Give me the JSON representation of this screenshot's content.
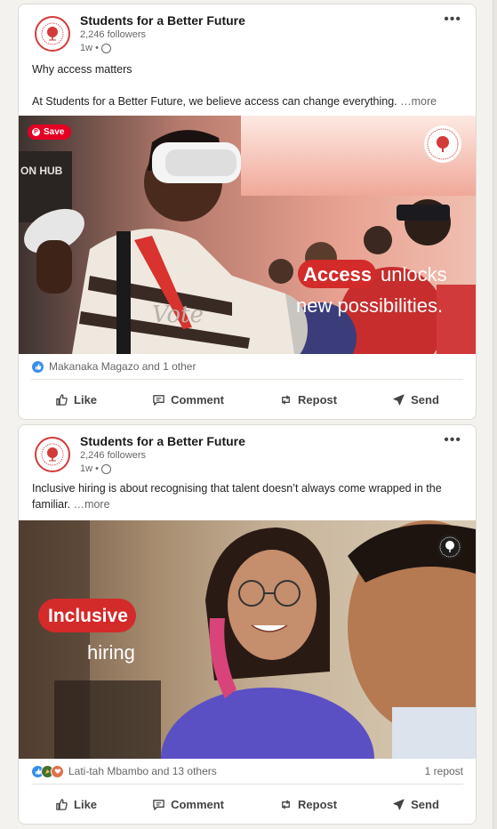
{
  "posts": [
    {
      "author": "Students for a Better Future",
      "followers": "2,246 followers",
      "time": "1w",
      "text_lines": [
        "Why access matters",
        "At Students for a Better Future, we believe access can change everything."
      ],
      "see_more": "…more",
      "image": {
        "save_label": "Save",
        "headline_highlight": "Access",
        "headline_rest": "unlocks",
        "headline_line2": "new possibilities.",
        "shirt_text": "Vote"
      },
      "reactions_text": "Makanaka Magazo and 1 other",
      "reactions_icons": [
        "like-icon"
      ],
      "reposts": ""
    },
    {
      "author": "Students for a Better Future",
      "followers": "2,246 followers",
      "time": "1w",
      "text_lines": [
        "Inclusive hiring is about recognising that talent doesn’t always come wrapped in the familiar."
      ],
      "see_more": "…more",
      "image": {
        "headline_highlight": "Inclusive",
        "headline_line2": "hiring"
      },
      "reactions_text": "Lati-tah Mbambo and 13 others",
      "reactions_icons": [
        "like-icon",
        "celebrate-icon",
        "love-icon"
      ],
      "reposts": "1 repost"
    }
  ],
  "actions": {
    "like": "Like",
    "comment": "Comment",
    "repost": "Repost",
    "send": "Send"
  },
  "colors": {
    "brand_red": "#d33a3a",
    "pinterest_red": "#e60023",
    "like_blue": "#378fe9",
    "background": "#f4f2ee"
  }
}
